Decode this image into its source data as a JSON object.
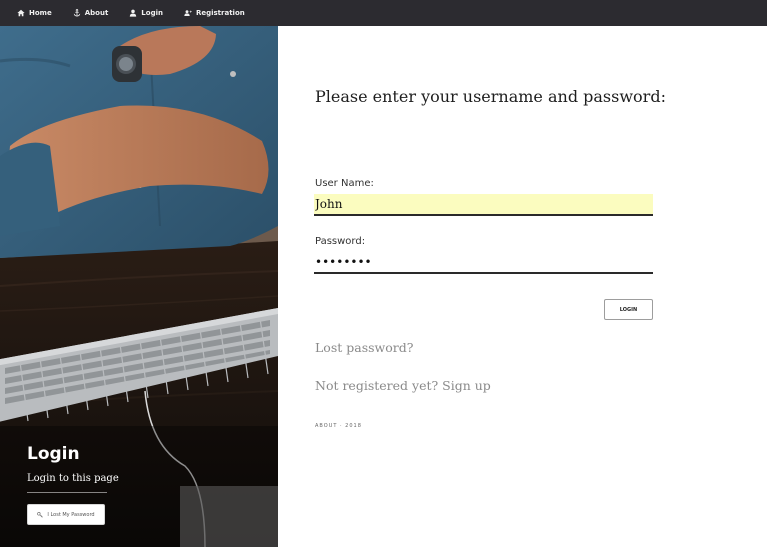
{
  "nav": {
    "items": [
      {
        "label": "Home",
        "icon": "home-icon"
      },
      {
        "label": "About",
        "icon": "anchor-icon"
      },
      {
        "label": "Login",
        "icon": "user-icon"
      },
      {
        "label": "Registration",
        "icon": "user-plus-icon"
      }
    ]
  },
  "sidebar": {
    "title": "Login",
    "subtitle": "Login to this page",
    "lost_button": {
      "label": "I Lost My Password",
      "icon": "key-icon"
    }
  },
  "form": {
    "heading": "Please enter your username and password:",
    "username_label": "User Name:",
    "username_value": "John",
    "password_label": "Password:",
    "password_value": "••••••••",
    "login_button": "LOGIN",
    "lost_password_link": "Lost password?",
    "signup_link": "Not registered yet? Sign up",
    "footer": "ABOUT · 2018"
  },
  "colors": {
    "nav_bg": "#2c2b30",
    "username_field_bg": "#fbfcbf",
    "link_color": "#8a8a8a"
  }
}
